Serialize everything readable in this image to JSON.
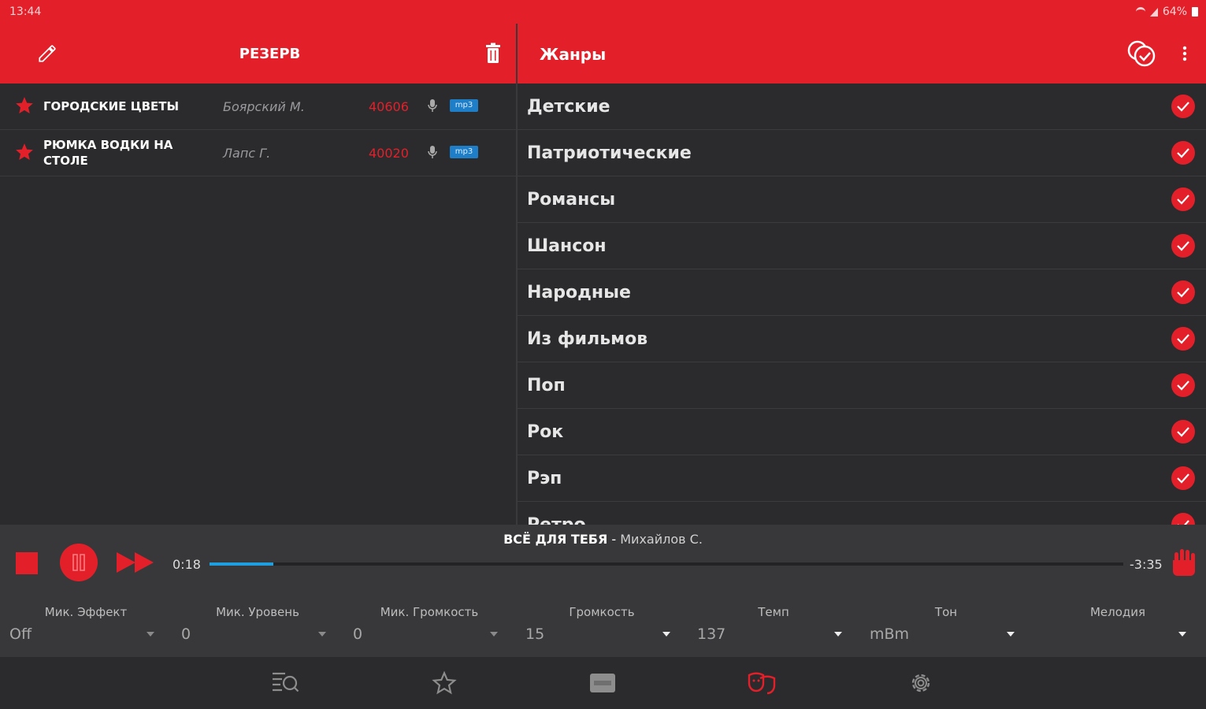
{
  "status_bar": {
    "time": "13:44",
    "battery": "64%"
  },
  "left_panel": {
    "title": "РЕЗЕРВ",
    "songs": [
      {
        "name": "ГОРОДСКИЕ ЦВЕТЫ",
        "artist": "Боярский М.",
        "code": "40606",
        "format": "mp3"
      },
      {
        "name": "РЮМКА ВОДКИ НА СТОЛЕ",
        "artist": "Лапс Г.",
        "code": "40020",
        "format": "mp3"
      }
    ]
  },
  "right_panel": {
    "title": "Жанры",
    "genres": [
      "Детские",
      "Патриотические",
      "Романсы",
      "Шансон",
      "Народные",
      "Из фильмов",
      "Поп",
      "Рок",
      "Рэп",
      "Ретро"
    ]
  },
  "player": {
    "song_title": "ВСЁ ДЛЯ ТЕБЯ",
    "separator": " - ",
    "artist": "Михайлов С.",
    "elapsed": "0:18",
    "remaining": "-3:35",
    "progress": 0.07
  },
  "controls": [
    {
      "label": "Мик. Эффект",
      "value": "Off"
    },
    {
      "label": "Мик. Уровень",
      "value": "0"
    },
    {
      "label": "Мик. Громкость",
      "value": "0"
    },
    {
      "label": "Громкость",
      "value": "15"
    },
    {
      "label": "Темп",
      "value": "137"
    },
    {
      "label": "Тон",
      "value": "mBm"
    },
    {
      "label": "Мелодия",
      "value": ""
    }
  ],
  "colors": {
    "accent": "#e3202a",
    "background": "#2b2b2d",
    "panel": "#38383a",
    "progress": "#1e9fe0"
  },
  "icons": [
    "pencil-icon",
    "trash-icon",
    "check-all-icon",
    "more-vert-icon",
    "star-icon",
    "mic-icon",
    "stop-icon",
    "pause-icon",
    "fast-forward-icon",
    "hand-icon",
    "playlist-search-icon",
    "favorites-icon",
    "new-icon",
    "genres-icon",
    "settings-icon"
  ]
}
